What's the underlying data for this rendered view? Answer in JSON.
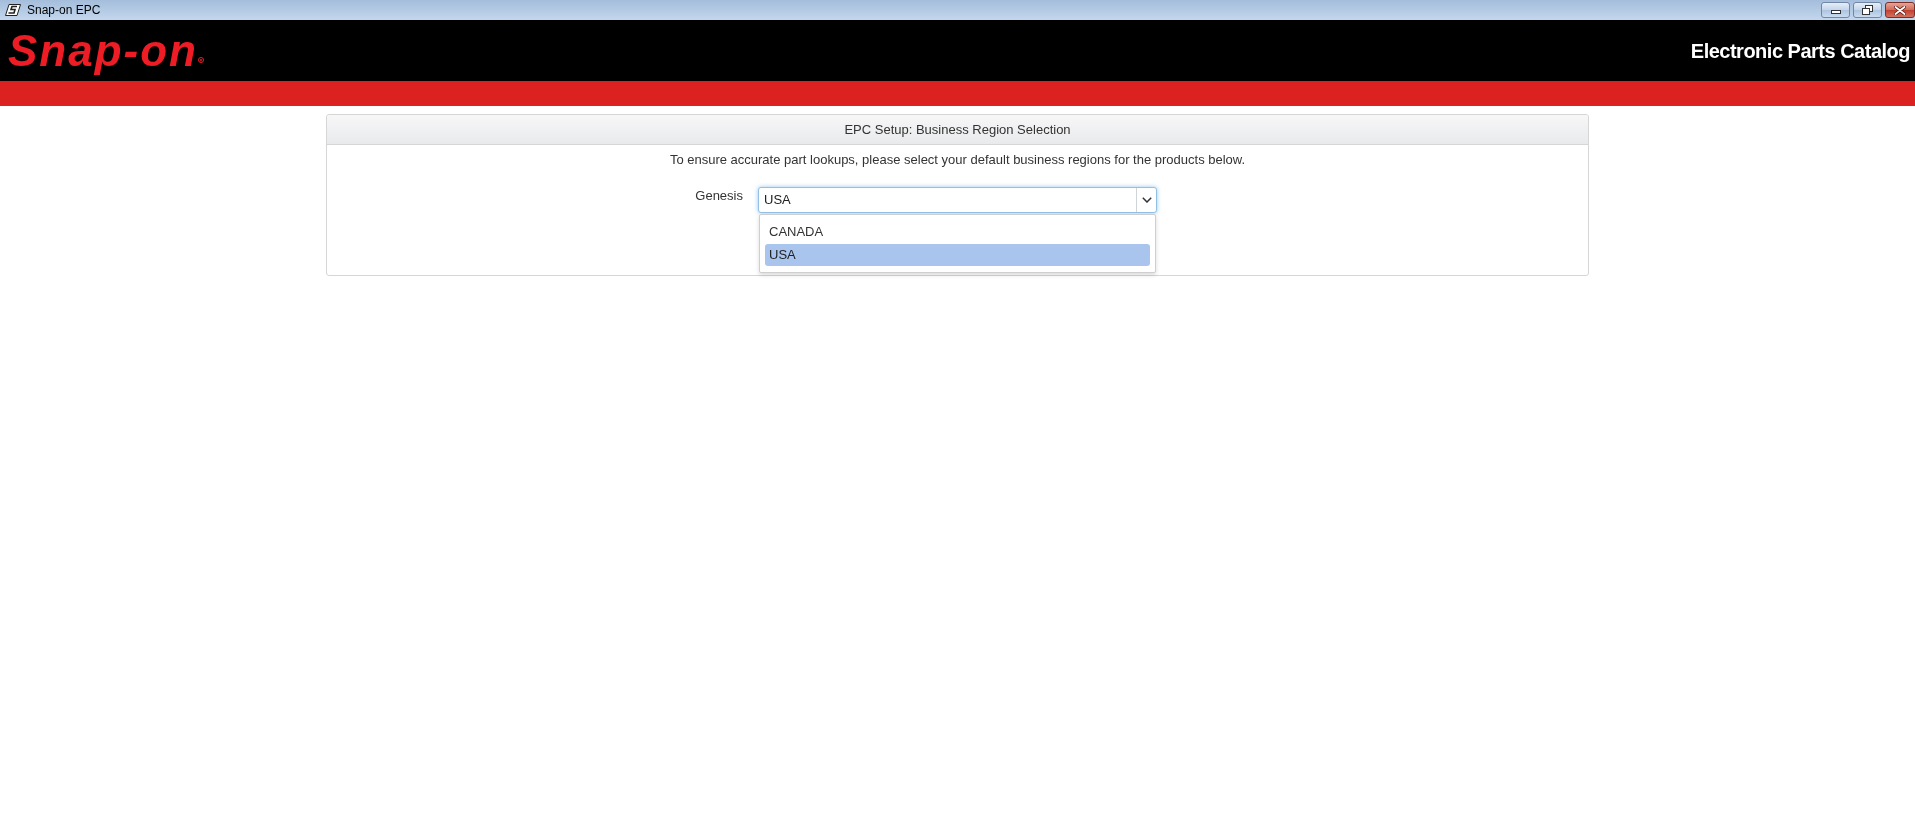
{
  "window": {
    "title": "Snap-on EPC",
    "controls": [
      {
        "kind": "minimize"
      },
      {
        "kind": "restore"
      },
      {
        "kind": "close"
      }
    ]
  },
  "header": {
    "logo": "Snap-on",
    "title": "Electronic Parts Catalog"
  },
  "panel": {
    "title": "EPC Setup: Business Region Selection",
    "description": "To ensure accurate part lookups, please select your default business regions for the products below.",
    "fields": [
      {
        "label": "Genesis",
        "value": "USA",
        "expanded": true,
        "options": [
          {
            "label": "CANADA",
            "selected": false
          },
          {
            "label": "USA",
            "selected": true
          }
        ]
      }
    ]
  }
}
